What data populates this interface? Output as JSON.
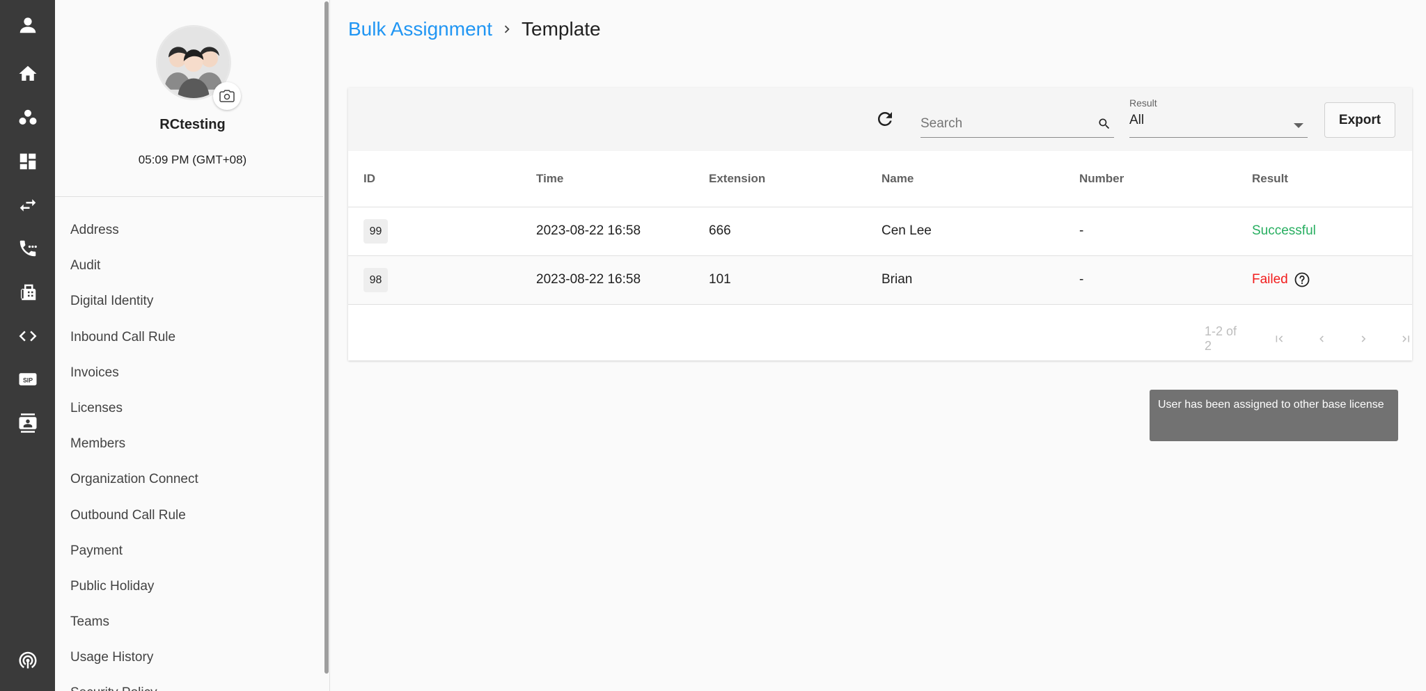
{
  "rail": {
    "items": [
      "profile",
      "home",
      "contacts",
      "dashboard",
      "transfer",
      "calls",
      "fax",
      "developer",
      "sip",
      "directory",
      "broadcast"
    ]
  },
  "profile": {
    "name": "RCtesting",
    "time": "05:09 PM (GMT+08)"
  },
  "nav": {
    "items": [
      "Address",
      "Audit",
      "Digital Identity",
      "Inbound Call Rule",
      "Invoices",
      "Licenses",
      "Members",
      "Organization Connect",
      "Outbound Call Rule",
      "Payment",
      "Public Holiday",
      "Teams",
      "Usage History",
      "Security Policy"
    ]
  },
  "breadcrumb": {
    "parent": "Bulk Assignment",
    "current": "Template"
  },
  "toolbar": {
    "search_placeholder": "Search",
    "result_label": "Result",
    "result_value": "All",
    "export_label": "Export"
  },
  "table": {
    "headers": [
      "ID",
      "Time",
      "Extension",
      "Name",
      "Number",
      "Result"
    ],
    "rows": [
      {
        "id": "99",
        "time": "2023-08-22 16:58",
        "extension": "666",
        "name": "Cen Lee",
        "number": "-",
        "result": "Successful"
      },
      {
        "id": "98",
        "time": "2023-08-22 16:58",
        "extension": "101",
        "name": "Brian",
        "number": "-",
        "result": "Failed"
      }
    ]
  },
  "pager": {
    "text": "1-2 of 2"
  },
  "tooltip": {
    "text": "User has been assigned to other base license"
  },
  "colors": {
    "accent": "#2196f3",
    "success": "#27ae60",
    "error": "#f21c1c",
    "rail": "#3a3a3a"
  }
}
